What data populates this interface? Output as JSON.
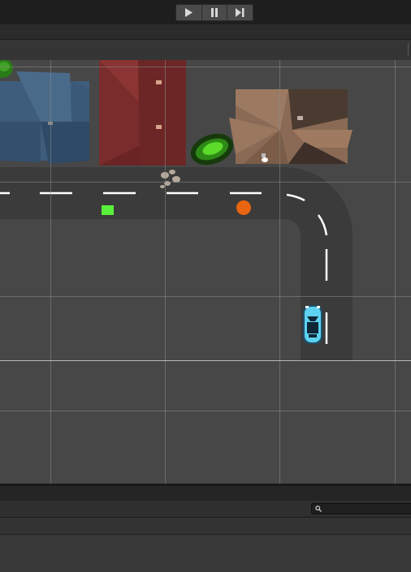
{
  "toolbar": {
    "controls": [
      {
        "name": "play-button",
        "icon": "play-icon"
      },
      {
        "name": "pause-button",
        "icon": "pause-icon"
      },
      {
        "name": "step-button",
        "icon": "step-forward-icon"
      }
    ]
  },
  "scene": {
    "background_color": "#474747",
    "road_color": "#3b3b3b",
    "lane_marking_color": "#ffffff",
    "grid_color": "#8a8a8a",
    "objects": [
      {
        "name": "house-blue",
        "color": "#3f5f7f"
      },
      {
        "name": "house-red",
        "color": "#7a2a2a"
      },
      {
        "name": "house-brown",
        "color": "#8a6a55"
      },
      {
        "name": "bush",
        "color": "#3cb81e"
      },
      {
        "name": "player-car",
        "color": "#5cd2f0"
      },
      {
        "name": "green-marker",
        "color": "#5aef3a"
      },
      {
        "name": "orange-marker",
        "color": "#e86511"
      }
    ]
  },
  "bottom_panel": {
    "search_placeholder": ""
  }
}
